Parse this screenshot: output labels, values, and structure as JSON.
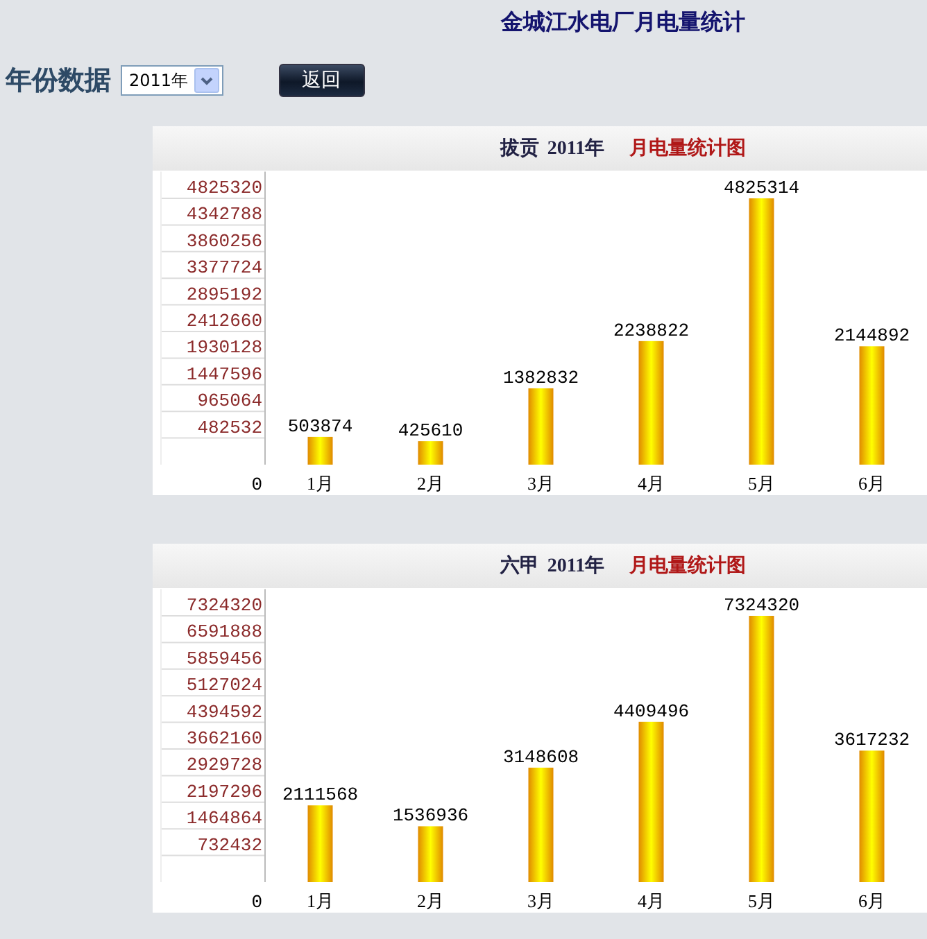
{
  "page_title": "金城江水电厂月电量统计",
  "filter": {
    "label": "年份数据",
    "year_select": {
      "value": "2011年"
    },
    "back_button": "返回"
  },
  "charts": [
    {
      "station": "拔贡",
      "year": "2011年",
      "title": "月电量统计图",
      "zero_label": "0",
      "chart_data": {
        "type": "bar",
        "categories": [
          "1月",
          "2月",
          "3月",
          "4月",
          "5月",
          "6月"
        ],
        "values": [
          503874,
          425610,
          1382832,
          2238822,
          4825314,
          2144892
        ],
        "value_labels": [
          "503874",
          "425610",
          "1382832",
          "2238822",
          "4825314",
          "2144892"
        ],
        "ylim": [
          0,
          4825320
        ],
        "yticks": [
          482532,
          965064,
          1447596,
          1930128,
          2412660,
          2895192,
          3377724,
          3860256,
          4342788,
          4825320
        ],
        "data_labels": true
      }
    },
    {
      "station": "六甲",
      "year": "2011年",
      "title": "月电量统计图",
      "zero_label": "0",
      "chart_data": {
        "type": "bar",
        "categories": [
          "1月",
          "2月",
          "3月",
          "4月",
          "5月",
          "6月"
        ],
        "values": [
          2111568,
          1536936,
          3148608,
          4409496,
          7324320,
          3617232
        ],
        "value_labels": [
          "2111568",
          "1536936",
          "3148608",
          "4409496",
          "7324320",
          "3617232"
        ],
        "ylim": [
          0,
          7324320
        ],
        "yticks": [
          732432,
          1464864,
          2197296,
          2929728,
          3662160,
          4394592,
          5127024,
          5859456,
          6591888,
          7324320
        ],
        "data_labels": true
      }
    }
  ]
}
